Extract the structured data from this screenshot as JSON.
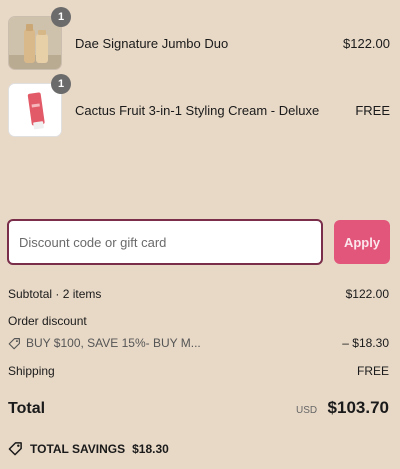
{
  "cart": {
    "items": [
      {
        "name": "Dae Signature Jumbo Duo",
        "price": "$122.00",
        "quantity": "1",
        "image_icon": "product-duo-bottles-image"
      },
      {
        "name": "Cactus Fruit 3-in-1 Styling Cream - Deluxe",
        "price": "FREE",
        "quantity": "1",
        "image_icon": "product-tube-image"
      }
    ]
  },
  "discount": {
    "placeholder": "Discount code or gift card",
    "apply_label": "Apply"
  },
  "summary": {
    "subtotal_label": "Subtotal · 2 items",
    "subtotal_value": "$122.00",
    "order_discount_label": "Order discount",
    "discount_code": "BUY $100, SAVE 15%- BUY M...",
    "discount_value": "– $18.30",
    "shipping_label": "Shipping",
    "shipping_value": "FREE",
    "total_label": "Total",
    "currency": "USD",
    "total_value": "$103.70",
    "savings_label": "TOTAL SAVINGS",
    "savings_value": "$18.30"
  },
  "colors": {
    "page_background": "#e8d9c7",
    "accent_button": "#e2567c",
    "input_border": "#7a2e4a",
    "badge": "#6b6b6b"
  }
}
